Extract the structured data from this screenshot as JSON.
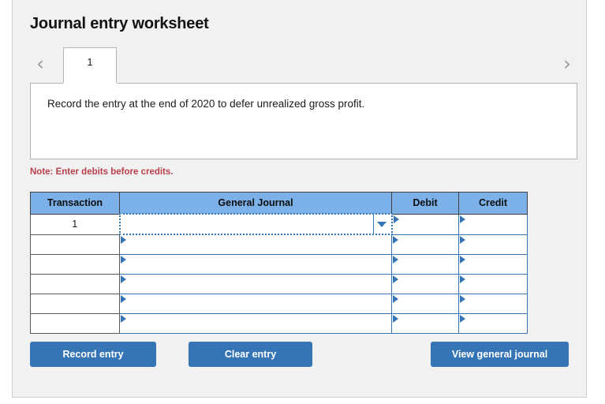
{
  "page_title": "Journal entry worksheet",
  "nav": {
    "prev_icon": "chevron-left-icon",
    "next_icon": "chevron-right-icon",
    "tabs": [
      {
        "label": "1",
        "active": true
      }
    ]
  },
  "instruction": {
    "text": "Record the entry at the end of 2020 to defer unrealized gross profit."
  },
  "note": "Note: Enter debits before credits.",
  "table": {
    "headers": [
      "Transaction",
      "General Journal",
      "Debit",
      "Credit"
    ],
    "rows": [
      {
        "transaction": "1",
        "general_journal": "",
        "debit": "",
        "credit": "",
        "active": true
      },
      {
        "transaction": "",
        "general_journal": "",
        "debit": "",
        "credit": "",
        "active": false
      },
      {
        "transaction": "",
        "general_journal": "",
        "debit": "",
        "credit": "",
        "active": false
      },
      {
        "transaction": "",
        "general_journal": "",
        "debit": "",
        "credit": "",
        "active": false
      },
      {
        "transaction": "",
        "general_journal": "",
        "debit": "",
        "credit": "",
        "active": false
      },
      {
        "transaction": "",
        "general_journal": "",
        "debit": "",
        "credit": "",
        "active": false
      }
    ]
  },
  "buttons": {
    "record": "Record entry",
    "clear": "Clear entry",
    "view": "View general journal"
  },
  "colors": {
    "accent_blue": "#3575b5",
    "header_blue": "#7bb0e8",
    "note_red": "#b7404a",
    "card_bg": "#f1f1f1"
  }
}
